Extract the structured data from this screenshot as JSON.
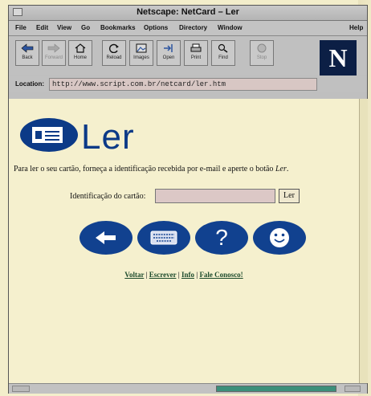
{
  "window": {
    "title": "Netscape: NetCard – Ler"
  },
  "menu": [
    "File",
    "Edit",
    "View",
    "Go",
    "Bookmarks",
    "Options",
    "Directory",
    "Window",
    "Help"
  ],
  "toolbar": {
    "buttons": [
      {
        "label": "Back",
        "icon": "back-arrow-icon"
      },
      {
        "label": "Forward",
        "icon": "forward-arrow-icon",
        "disabled": true
      },
      {
        "label": "Home",
        "icon": "home-icon"
      },
      {
        "label": "Reload",
        "icon": "reload-icon"
      },
      {
        "label": "Images",
        "icon": "images-icon"
      },
      {
        "label": "Open",
        "icon": "open-icon"
      },
      {
        "label": "Print",
        "icon": "printer-icon"
      },
      {
        "label": "Find",
        "icon": "find-icon"
      },
      {
        "label": "Stop",
        "icon": "stop-icon",
        "disabled": true
      }
    ],
    "brand_logo": "N"
  },
  "location": {
    "label": "Location:",
    "url": "http://www.script.com.br/netcard/ler.htm"
  },
  "page": {
    "title": "Ler",
    "instructions_main": "Para ler o seu cartão, forneça a identificação recebida por e-mail e aperte o botão ",
    "instructions_em": "Ler",
    "instructions_end": ".",
    "field_label": "Identificação do cartão:",
    "field_value": "",
    "submit_label": "Ler",
    "nav_buttons": [
      {
        "name": "back",
        "icon": "left-arrow-icon"
      },
      {
        "name": "write",
        "icon": "keyboard-icon"
      },
      {
        "name": "info",
        "icon": "question-mark-icon",
        "glyph": "?"
      },
      {
        "name": "contact",
        "icon": "smiley-icon"
      }
    ],
    "links": [
      "Voltar",
      "Escrever",
      "Info",
      "Fale Conosco!"
    ],
    "link_separator": " | "
  },
  "colors": {
    "accent_blue": "#11418f",
    "page_background": "#f5f0ce",
    "field_background": "#dcc8c6",
    "progress": "#3c8f7a"
  }
}
